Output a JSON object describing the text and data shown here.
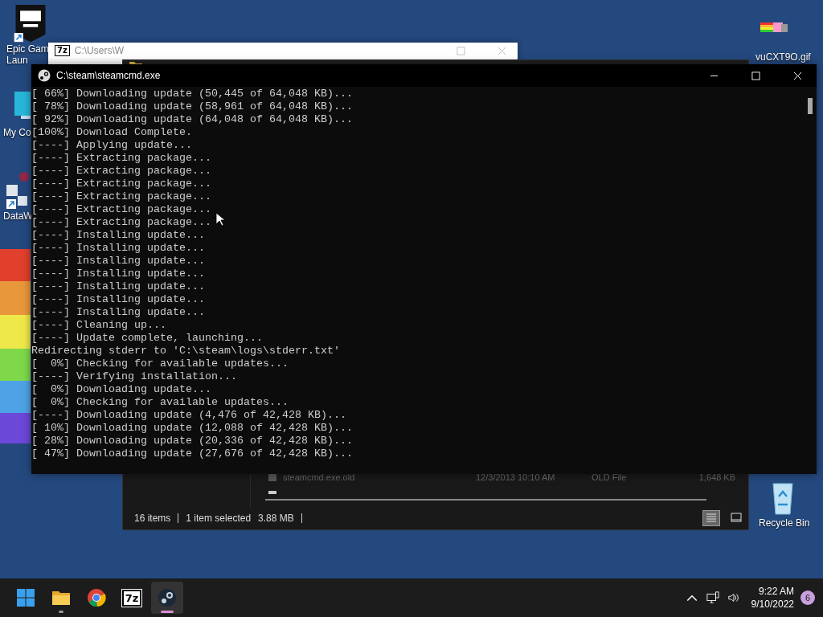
{
  "desktop_icons": [
    {
      "kind": "epic",
      "lines": [
        "Epic Gam",
        "Laun"
      ]
    },
    {
      "kind": "computer",
      "lines": [
        "My Co"
      ]
    },
    {
      "kind": "shortcut",
      "lines": [
        "DataW"
      ]
    },
    {
      "kind": "gif",
      "lines": [
        "vuCXT9O.gif"
      ]
    },
    {
      "kind": "recycle",
      "lines": [
        "Recycle Bin"
      ]
    }
  ],
  "archive_window": {
    "icon_label": "7z",
    "title": "C:\\Users\\W"
  },
  "explorer_window": {
    "file_row": {
      "name": "steamcmd.exe.old",
      "date": "12/3/2013 10:10 AM",
      "type": "OLD File",
      "size": "1,648 KB"
    },
    "status_bar": {
      "count": "16 items",
      "selection": "1 item selected",
      "size": "3.88 MB"
    },
    "views": [
      {
        "kind": "details",
        "selected": true
      },
      {
        "kind": "tiles",
        "selected": false
      }
    ]
  },
  "console_window": {
    "title": "C:\\steam\\steamcmd.exe",
    "lines": [
      "[ 66%] Downloading update (50,445 of 64,048 KB)...",
      "[ 78%] Downloading update (58,961 of 64,048 KB)...",
      "[ 92%] Downloading update (64,048 of 64,048 KB)...",
      "[100%] Download Complete.",
      "[----] Applying update...",
      "[----] Extracting package...",
      "[----] Extracting package...",
      "[----] Extracting package...",
      "[----] Extracting package...",
      "[----] Extracting package...",
      "[----] Extracting package...",
      "[----] Installing update...",
      "[----] Installing update...",
      "[----] Installing update...",
      "[----] Installing update...",
      "[----] Installing update...",
      "[----] Installing update...",
      "[----] Installing update...",
      "[----] Cleaning up...",
      "[----] Update complete, launching...",
      "Redirecting stderr to 'C:\\steam\\logs\\stderr.txt'",
      "[  0%] Checking for available updates...",
      "[----] Verifying installation...",
      "[  0%] Downloading update...",
      "[  0%] Checking for available updates...",
      "[----] Downloading update (4,476 of 42,428 KB)...",
      "[ 10%] Downloading update (12,088 of 42,428 KB)...",
      "[ 28%] Downloading update (20,336 of 42,428 KB)...",
      "[ 47%] Downloading update (27,676 of 42,428 KB)..."
    ]
  },
  "taskbar": {
    "apps": [
      {
        "kind": "start",
        "running": false,
        "selected": false
      },
      {
        "kind": "folder",
        "running": true,
        "selected": false
      },
      {
        "kind": "chrome",
        "running": false,
        "selected": false
      },
      {
        "kind": "sevenzip",
        "label": "7z",
        "running": false,
        "selected": false
      },
      {
        "kind": "steam",
        "running": true,
        "selected": true
      }
    ],
    "time": "9:22 AM",
    "date": "9/10/2022",
    "notifications": "6"
  }
}
